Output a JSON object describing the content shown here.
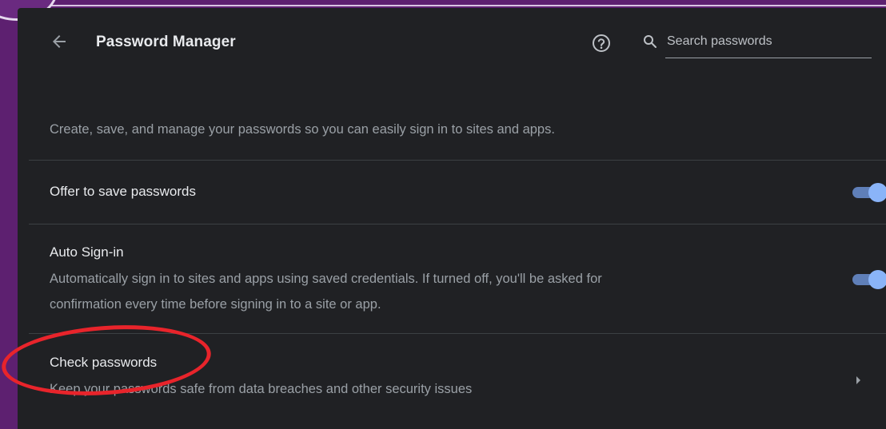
{
  "header": {
    "title": "Password Manager",
    "back_icon": "arrow-left-icon",
    "help_icon": "help-circle-icon",
    "search_icon": "search-icon",
    "search_placeholder": "Search passwords"
  },
  "description": "Create, save, and manage your passwords so you can easily sign in to sites and apps.",
  "settings": [
    {
      "title": "Offer to save passwords",
      "subtitle": "",
      "control": "toggle",
      "enabled": true
    },
    {
      "title": "Auto Sign-in",
      "subtitle_line1": "Automatically sign in to sites and apps using saved credentials. If turned off, you'll be asked for",
      "subtitle_line2": "confirmation every time before signing in to a site or app.",
      "control": "toggle",
      "enabled": true
    },
    {
      "title": "Check passwords",
      "subtitle": "Keep your passwords safe from data breaches and other security issues",
      "control": "chevron",
      "chevron_icon": "chevron-right-icon"
    }
  ],
  "colors": {
    "frame": "#5d2070",
    "panel": "#202124",
    "toggle_track": "#5f7fb8",
    "toggle_knob": "#8ab4f8",
    "annotation": "#e8242b"
  }
}
